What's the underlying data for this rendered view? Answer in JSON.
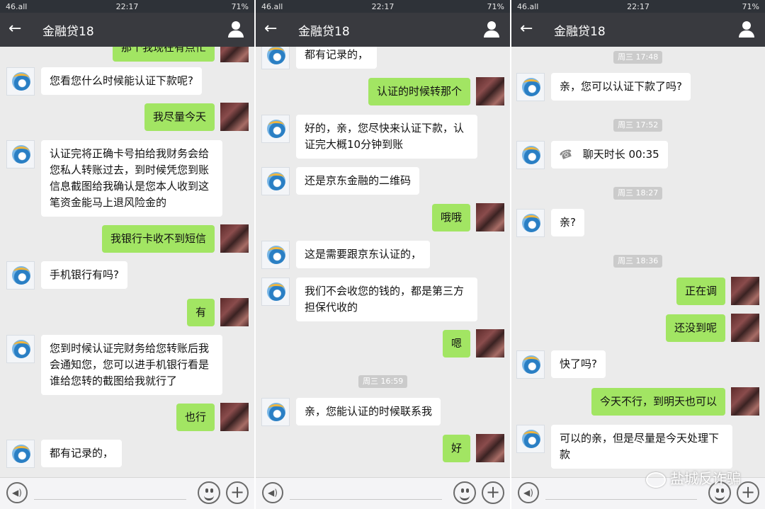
{
  "status": {
    "signal": "46.all",
    "time": "22:17",
    "battery": "71%"
  },
  "chat": {
    "title": "金融贷18",
    "back_icon": "←"
  },
  "panels": [
    {
      "messages": [
        {
          "side": "right",
          "text": "那个我现在有点忙"
        },
        {
          "side": "left",
          "text": "您看您什么时候能认证下款呢?"
        },
        {
          "side": "right",
          "text": "我尽量今天"
        },
        {
          "side": "left",
          "text": "认证完将正确卡号拍给我财务会给您私人转账过去，到时候凭您到账信息截图给我确认是您本人收到这笔资金能马上退风险金的"
        },
        {
          "side": "right",
          "text": "我银行卡收不到短信"
        },
        {
          "side": "left",
          "text": "手机银行有吗?"
        },
        {
          "side": "right",
          "text": "有"
        },
        {
          "side": "left",
          "text": "您到时候认证完财务给您转账后我会通知您，您可以进手机银行看是谁给您转的截图给我就行了"
        },
        {
          "side": "right",
          "text": "也行"
        },
        {
          "side": "left",
          "text": "都有记录的，"
        }
      ]
    },
    {
      "messages": [
        {
          "side": "left",
          "text": "都有记录的，"
        },
        {
          "side": "right",
          "text": "认证的时候转那个"
        },
        {
          "side": "left",
          "text": "好的，亲，您尽快来认证下款，认证完大概10分钟到账"
        },
        {
          "side": "left",
          "text": "还是京东金融的二维码"
        },
        {
          "side": "right",
          "text": "哦哦"
        },
        {
          "side": "left",
          "text": "这是需要跟京东认证的，"
        },
        {
          "side": "left",
          "text": "我们不会收您的钱的，都是第三方担保代收的"
        },
        {
          "side": "right",
          "text": "嗯"
        },
        {
          "time": "周三 16:59"
        },
        {
          "side": "left",
          "text": "亲，您能认证的时候联系我"
        },
        {
          "side": "right",
          "text": "好"
        }
      ]
    },
    {
      "messages": [
        {
          "time": "周三 17:48"
        },
        {
          "side": "left",
          "text": "亲，您可以认证下款了吗?"
        },
        {
          "time": "周三 17:52"
        },
        {
          "side": "left",
          "text": "聊天时长 00:35",
          "call": true
        },
        {
          "time": "周三 18:27"
        },
        {
          "side": "left",
          "text": "亲?"
        },
        {
          "time": "周三 18:36"
        },
        {
          "side": "right",
          "text": "正在调"
        },
        {
          "side": "right",
          "text": "还没到呢"
        },
        {
          "side": "left",
          "text": "快了吗?"
        },
        {
          "side": "right",
          "text": "今天不行，到明天也可以"
        },
        {
          "side": "left",
          "text": "可以的亲，但是尽量是今天处理下款"
        }
      ]
    }
  ],
  "watermark": "盐城反诈骗",
  "icons": {
    "back": "back-arrow-icon",
    "profile": "person-icon",
    "voice": "voice-icon",
    "emoji": "emoji-icon",
    "plus": "plus-icon",
    "call": "phone-icon"
  }
}
